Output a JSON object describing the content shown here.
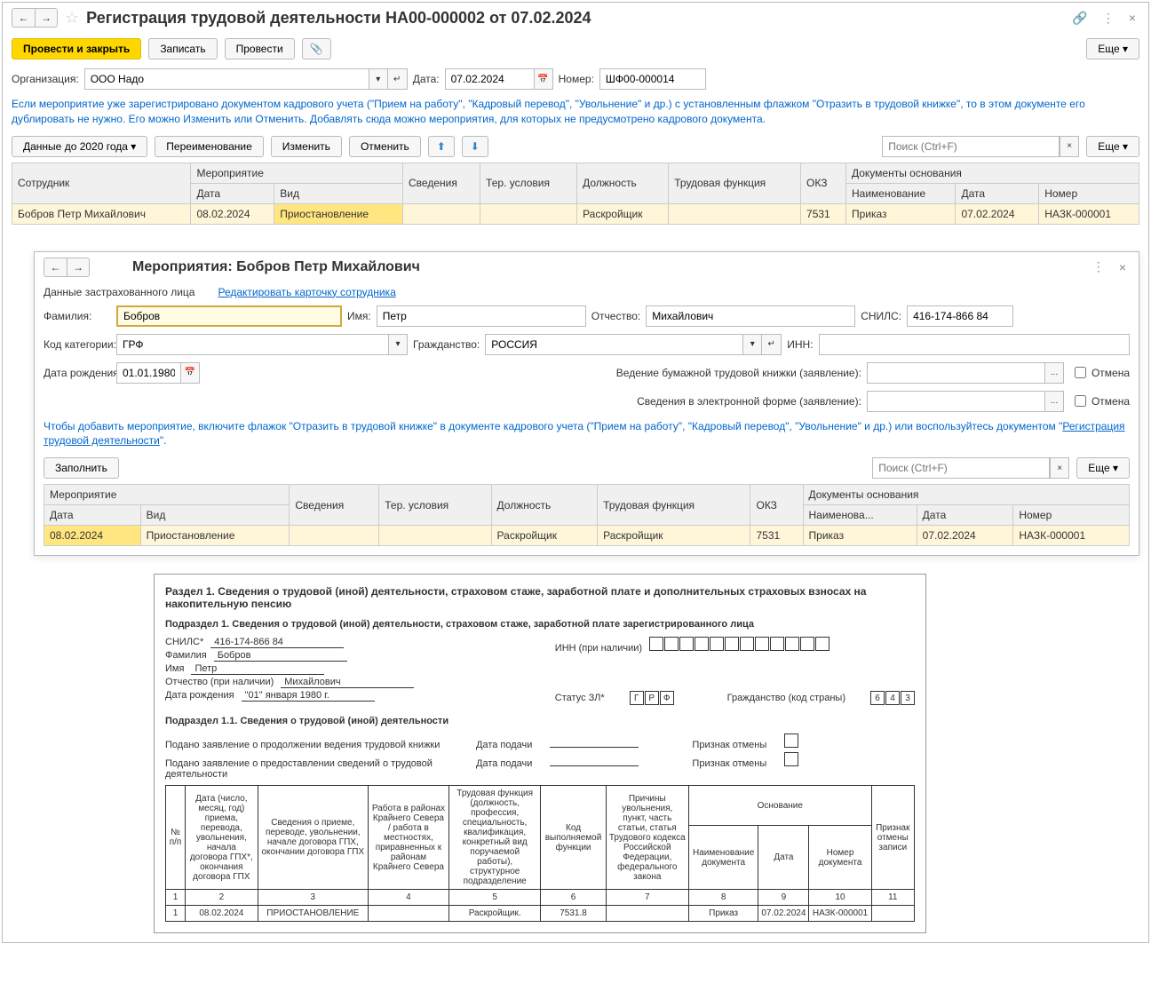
{
  "main": {
    "title": "Регистрация трудовой деятельности НА00-000002 от 07.02.2024",
    "btn_process_close": "Провести и закрыть",
    "btn_write": "Записать",
    "btn_process": "Провести",
    "btn_more": "Еще",
    "lbl_org": "Организация:",
    "val_org": "ООО Надо",
    "lbl_date": "Дата:",
    "val_date": "07.02.2024",
    "lbl_num": "Номер:",
    "val_num": "ШФ00-000014",
    "info": "Если мероприятие уже зарегистрировано документом кадрового учета (\"Прием на работу\", \"Кадровый перевод\", \"Увольнение\" и др.) с установленным флажком \"Отразить в трудовой книжке\", то в этом документе его дублировать не нужно. Его можно Изменить или Отменить. Добавлять сюда можно мероприятия, для которых не предусмотрено кадрового документа.",
    "btn_data2020": "Данные до 2020 года",
    "btn_rename": "Переименование",
    "btn_change": "Изменить",
    "btn_cancel": "Отменить",
    "search_ph": "Поиск (Ctrl+F)",
    "tbl": {
      "h_emp": "Сотрудник",
      "h_event": "Мероприятие",
      "h_info": "Сведения",
      "h_ter": "Тер. условия",
      "h_pos": "Должность",
      "h_func": "Трудовая функция",
      "h_okz": "ОКЗ",
      "h_docs": "Документы основания",
      "h_date": "Дата",
      "h_type": "Вид",
      "h_name": "Наименование",
      "h_docdate": "Дата",
      "h_docnum": "Номер",
      "r1_emp": "Бобров Петр Михайлович",
      "r1_date": "08.02.2024",
      "r1_type": "Приостановление",
      "r1_pos": "Раскройщик",
      "r1_okz": "7531",
      "r1_docname": "Приказ",
      "r1_docdate": "07.02.2024",
      "r1_docnum": "НАЗК-000001"
    }
  },
  "sub": {
    "title": "Мероприятия: Бобров Петр Михайлович",
    "lbl_insured": "Данные застрахованного лица",
    "link_edit": "Редактировать карточку сотрудника",
    "lbl_fam": "Фамилия:",
    "val_fam": "Бобров",
    "lbl_name": "Имя:",
    "val_name": "Петр",
    "lbl_patr": "Отчество:",
    "val_patr": "Михайлович",
    "lbl_snils": "СНИЛС:",
    "val_snils": "416-174-866 84",
    "lbl_cat": "Код категории:",
    "val_cat": "ГРФ",
    "lbl_cit": "Гражданство:",
    "val_cit": "РОССИЯ",
    "lbl_inn": "ИНН:",
    "lbl_dob": "Дата рождения:",
    "val_dob": "01.01.1980",
    "lbl_paper": "Ведение бумажной трудовой книжки (заявление):",
    "lbl_electronic": "Сведения в электронной форме (заявление):",
    "lbl_cancel_chk": "Отмена",
    "info2a": "Чтобы добавить мероприятие, включите флажок \"Отразить в трудовой книжке\" в документе кадрового учета (\"Прием на работу\", \"Кадровый перевод\", \"Увольнение\" и др.) или воспользуйтесь документом \"",
    "info2b": "Регистрация трудовой деятельности",
    "info2c": "\".",
    "btn_fill": "Заполнить",
    "tbl": {
      "h_event": "Мероприятие",
      "h_info": "Сведения",
      "h_ter": "Тер. условия",
      "h_pos": "Должность",
      "h_func": "Трудовая функция",
      "h_okz": "ОКЗ",
      "h_docs": "Документы основания",
      "h_date": "Дата",
      "h_type": "Вид",
      "h_name": "Наименова...",
      "h_docdate": "Дата",
      "h_docnum": "Номер",
      "r1_date": "08.02.2024",
      "r1_type": "Приостановление",
      "r1_pos": "Раскройщик",
      "r1_func": "Раскройщик",
      "r1_okz": "7531",
      "r1_docname": "Приказ",
      "r1_docdate": "07.02.2024",
      "r1_docnum": "НАЗК-000001"
    }
  },
  "report": {
    "section1": "Раздел 1. Сведения о трудовой (иной) деятельности, страховом стаже, заработной плате и дополнительных страховых взносах на накопительную пенсию",
    "subsection1": "Подраздел 1. Сведения о трудовой (иной) деятельности, страховом стаже, заработной плате зарегистрированного лица",
    "lbl_snils": "СНИЛС*",
    "val_snils": "416-174-866 84",
    "lbl_inn": "ИНН (при наличии)",
    "lbl_fam": "Фамилия",
    "val_fam": "Бобров",
    "lbl_name": "Имя",
    "val_name": "Петр",
    "lbl_patr": "Отчество (при наличии)",
    "val_patr": "Михайлович",
    "lbl_dob": "Дата рождения",
    "val_dob": "\"01\" января 1980 г.",
    "lbl_status": "Статус ЗЛ*",
    "status_boxes": [
      "Г",
      "Р",
      "Ф"
    ],
    "lbl_citizenship": "Гражданство (код страны)",
    "cit_boxes": [
      "6",
      "4",
      "3"
    ],
    "subsection11": "Подраздел 1.1. Сведения о трудовой (иной) деятельности",
    "stmt1": "Подано заявление о продолжении ведения трудовой книжки",
    "stmt2": "Подано заявление о предоставлении сведений о трудовой деятельности",
    "lbl_filed": "Дата подачи",
    "lbl_cancel_sign": "Признак отмены",
    "col_num": "№ п/п",
    "col1": "Дата (число, месяц, год) приема, перевода, увольнения, начала договора ГПХ*, окончания договора ГПХ",
    "col2": "Сведения о приеме, переводе, увольнении, начале договора ГПХ, окончании договора ГПХ",
    "col3": "Работа в районах Крайнего Севера / работа в местностях, приравненных к районам Крайнего Севера",
    "col4": "Трудовая функция (должность, профессия, специальность, квалификация, конкретный вид поручаемой работы), структурное подразделение",
    "col5": "Код выполняемой функции",
    "col6": "Причины увольнения, пункт, часть статьи, статья Трудового кодекса Российской Федерации, федерального закона",
    "col_base": "Основание",
    "col7": "Наименование документа",
    "col8": "Дата",
    "col9": "Номер документа",
    "col10": "Признак отмены записи",
    "row": {
      "n": "1",
      "c1": "08.02.2024",
      "c2": "ПРИОСТАНОВЛЕНИЕ",
      "c4": "Раскройщик.",
      "c5": "7531.8",
      "c7": "Приказ",
      "c8": "07.02.2024",
      "c9": "НАЗК-000001"
    }
  }
}
